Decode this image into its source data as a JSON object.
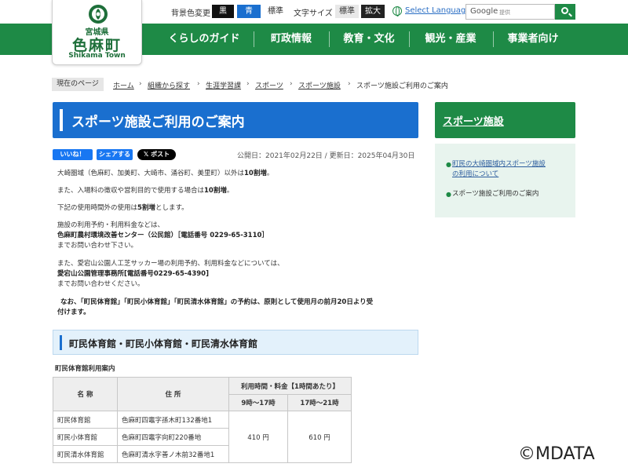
{
  "header": {
    "pref": "宮城県",
    "town": "色麻町",
    "town_en": "Shikama Town",
    "bg_color_label": "背景色変更",
    "bg_black": "黒",
    "bg_blue": "青",
    "bg_standard": "標準",
    "font_size_label": "文字サイズ",
    "font_standard": "標準",
    "font_large": "拡大",
    "select_language": "Select Language",
    "search_brand": "Google",
    "search_offered": "提供",
    "accent_color": "#1e8a46"
  },
  "nav": {
    "items": [
      {
        "label": "くらしのガイド"
      },
      {
        "label": "町政情報"
      },
      {
        "label": "教育・文化"
      },
      {
        "label": "観光・産業"
      },
      {
        "label": "事業者向け"
      }
    ]
  },
  "breadcrumb": {
    "current_label": "現在のページ",
    "items": [
      "ホーム",
      "組織から探す",
      "生涯学習課",
      "スポーツ",
      "スポーツ施設"
    ],
    "current": "スポーツ施設ご利用のご案内"
  },
  "main": {
    "title": "スポーツ施設ご利用のご案内",
    "title_color": "#1a6fcf",
    "sns": {
      "like": "いいね！",
      "share": "シェアする",
      "post": "ポスト"
    },
    "date": "公開日：2021年02月22日 / 更新日：2025年04月30日",
    "p1_a": "大崎圏域（色麻町、加美町、大崎市、涌谷町、美里町）以外は",
    "p1_b": "10割増",
    "p1_c": "。",
    "p2_a": "また、入場料の徴収や営利目的で使用する場合は",
    "p2_b": "10割増",
    "p2_c": "。",
    "p3_a": "下記の使用時間外の使用は",
    "p3_b": "5割増",
    "p3_c": "とします。",
    "p4_1": "施設の利用予約・利用料金などは、",
    "p4_2": "色麻町農村環境改善センター（公民館）［電話番号 0229-65-3110］",
    "p4_3": "までお問い合わせ下さい。",
    "p5_1": "また、愛宕山公園人工芝サッカー場の利用予約、利用料金などについては、",
    "p5_2": "愛宕山公園管理事務所[電話番号0229-65-4390]",
    "p5_3": "までお問い合わせください。",
    "p6_1": "なお、「町民体育館」「町民小体育館」「町民清水体育館」の予約は、原則として使用月の前月20日より受",
    "p6_2": "付けます。",
    "h2": "町民体育館・町民小体育館・町民清水体育館",
    "caption": "町民体育館利用案内"
  },
  "table": {
    "head_name": "名 称",
    "head_address": "住 所",
    "head_time": "利用時間・料金【1時間あたり】",
    "head_t1": "9時～17時",
    "head_t2": "17時～21時",
    "rows": [
      {
        "name": "町民体育館",
        "address": "色麻町四竈字孫木町132番地1"
      },
      {
        "name": "町民小体育館",
        "address": "色麻町四竈字向町220番地"
      },
      {
        "name": "町民清水体育館",
        "address": "色麻町清水字善ノ木前32番地1"
      }
    ],
    "fee_day": "410 円",
    "fee_night": "610 円"
  },
  "sidebar": {
    "title": "スポーツ施設",
    "links": [
      {
        "line1": "町民の大崎圏域内スポーツ施設",
        "line2": "の利用について"
      },
      {
        "line1": "スポーツ施設ご利用のご案内",
        "line2": ""
      }
    ]
  },
  "watermark": "©MDATA"
}
